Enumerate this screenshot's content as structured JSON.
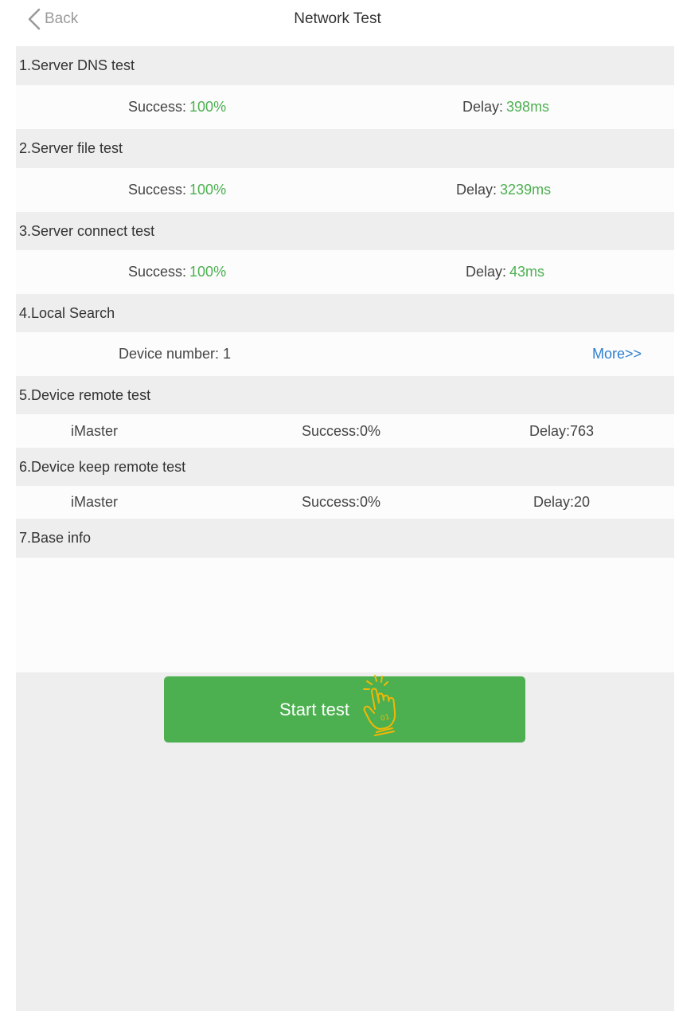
{
  "header": {
    "back_label": "Back",
    "back_icon": "chevron-left-icon",
    "title": "Network Test"
  },
  "sections": {
    "dns": {
      "title": "1.Server DNS test",
      "success_label": "Success:",
      "success_value": "100%",
      "delay_label": "Delay:",
      "delay_value": "398ms"
    },
    "file": {
      "title": "2.Server file test",
      "success_label": "Success:",
      "success_value": "100%",
      "delay_label": "Delay:",
      "delay_value": "3239ms"
    },
    "connect": {
      "title": "3.Server connect test",
      "success_label": "Success:",
      "success_value": "100%",
      "delay_label": "Delay:",
      "delay_value": "43ms"
    },
    "local": {
      "title": "4.Local Search",
      "device_label": "Device number: 1",
      "more_label": "More>>"
    },
    "remote": {
      "title": "5.Device remote test",
      "device": "iMaster",
      "success": "Success:0%",
      "delay": "Delay:763"
    },
    "keep_remote": {
      "title": "6.Device keep remote test",
      "device": "iMaster",
      "success": "Success:0%",
      "delay": "Delay:20"
    },
    "base_info": {
      "title": "7.Base info"
    }
  },
  "footer": {
    "start_label": "Start test",
    "start_icon": "tap-hand-icon"
  },
  "colors": {
    "success_green": "#4cb050",
    "link_blue": "#2e7fd0",
    "button_green": "#4cb050",
    "hand_gold": "#f2b705"
  }
}
